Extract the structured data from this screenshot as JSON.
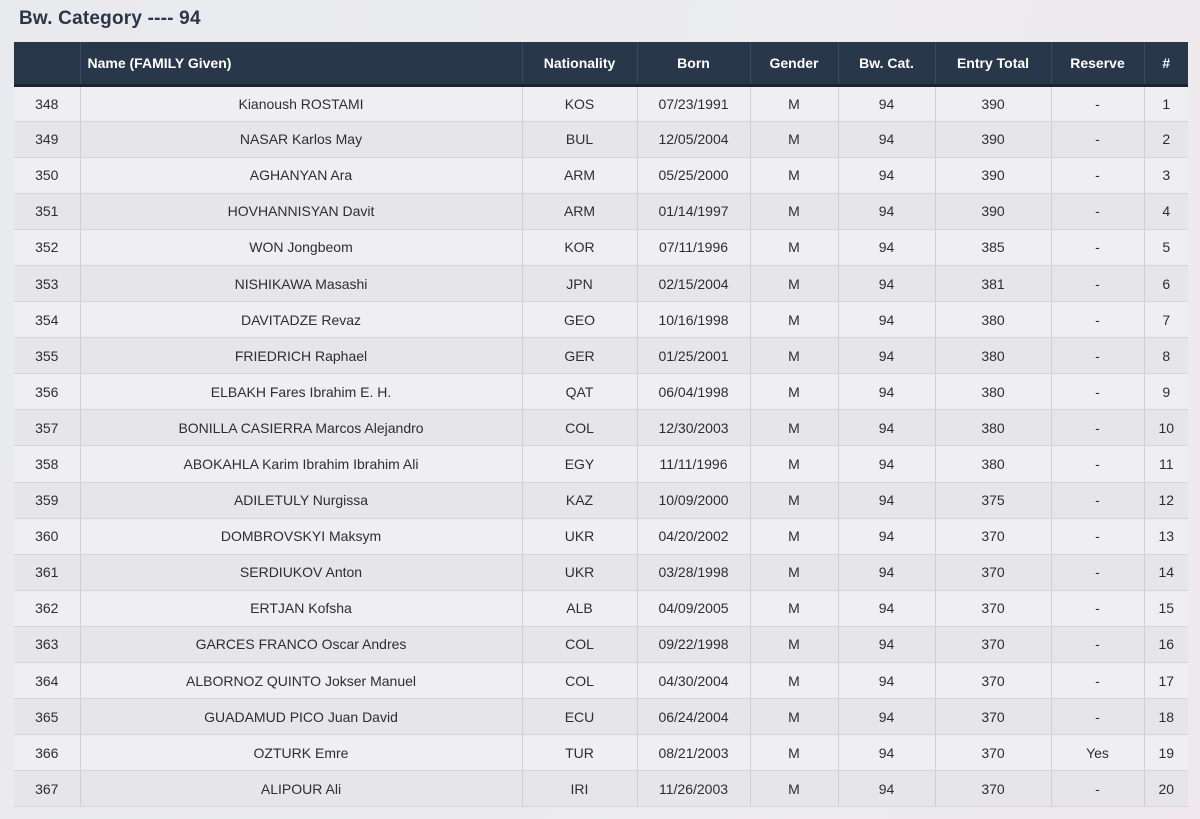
{
  "title": "Bw. Category ---- 94",
  "columns": {
    "id": "",
    "name": "Name (FAMILY Given)",
    "nationality": "Nationality",
    "born": "Born",
    "gender": "Gender",
    "bw_cat": "Bw. Cat.",
    "entry_total": "Entry Total",
    "reserve": "Reserve",
    "rank": "#"
  },
  "rows": [
    {
      "id": "348",
      "name": "Kianoush ROSTAMI",
      "nationality": "KOS",
      "born": "07/23/1991",
      "gender": "M",
      "bw_cat": "94",
      "entry_total": "390",
      "reserve": "-",
      "rank": "1"
    },
    {
      "id": "349",
      "name": "NASAR Karlos May",
      "nationality": "BUL",
      "born": "12/05/2004",
      "gender": "M",
      "bw_cat": "94",
      "entry_total": "390",
      "reserve": "-",
      "rank": "2"
    },
    {
      "id": "350",
      "name": "AGHANYAN Ara",
      "nationality": "ARM",
      "born": "05/25/2000",
      "gender": "M",
      "bw_cat": "94",
      "entry_total": "390",
      "reserve": "-",
      "rank": "3"
    },
    {
      "id": "351",
      "name": "HOVHANNISYAN Davit",
      "nationality": "ARM",
      "born": "01/14/1997",
      "gender": "M",
      "bw_cat": "94",
      "entry_total": "390",
      "reserve": "-",
      "rank": "4"
    },
    {
      "id": "352",
      "name": "WON Jongbeom",
      "nationality": "KOR",
      "born": "07/11/1996",
      "gender": "M",
      "bw_cat": "94",
      "entry_total": "385",
      "reserve": "-",
      "rank": "5"
    },
    {
      "id": "353",
      "name": "NISHIKAWA Masashi",
      "nationality": "JPN",
      "born": "02/15/2004",
      "gender": "M",
      "bw_cat": "94",
      "entry_total": "381",
      "reserve": "-",
      "rank": "6"
    },
    {
      "id": "354",
      "name": "DAVITADZE Revaz",
      "nationality": "GEO",
      "born": "10/16/1998",
      "gender": "M",
      "bw_cat": "94",
      "entry_total": "380",
      "reserve": "-",
      "rank": "7"
    },
    {
      "id": "355",
      "name": "FRIEDRICH Raphael",
      "nationality": "GER",
      "born": "01/25/2001",
      "gender": "M",
      "bw_cat": "94",
      "entry_total": "380",
      "reserve": "-",
      "rank": "8"
    },
    {
      "id": "356",
      "name": "ELBAKH Fares Ibrahim E. H.",
      "nationality": "QAT",
      "born": "06/04/1998",
      "gender": "M",
      "bw_cat": "94",
      "entry_total": "380",
      "reserve": "-",
      "rank": "9"
    },
    {
      "id": "357",
      "name": "BONILLA CASIERRA Marcos Alejandro",
      "nationality": "COL",
      "born": "12/30/2003",
      "gender": "M",
      "bw_cat": "94",
      "entry_total": "380",
      "reserve": "-",
      "rank": "10"
    },
    {
      "id": "358",
      "name": "ABOKAHLA Karim Ibrahim Ibrahim Ali",
      "nationality": "EGY",
      "born": "11/11/1996",
      "gender": "M",
      "bw_cat": "94",
      "entry_total": "380",
      "reserve": "-",
      "rank": "11"
    },
    {
      "id": "359",
      "name": "ADILETULY Nurgissa",
      "nationality": "KAZ",
      "born": "10/09/2000",
      "gender": "M",
      "bw_cat": "94",
      "entry_total": "375",
      "reserve": "-",
      "rank": "12"
    },
    {
      "id": "360",
      "name": "DOMBROVSKYI Maksym",
      "nationality": "UKR",
      "born": "04/20/2002",
      "gender": "M",
      "bw_cat": "94",
      "entry_total": "370",
      "reserve": "-",
      "rank": "13"
    },
    {
      "id": "361",
      "name": "SERDIUKOV Anton",
      "nationality": "UKR",
      "born": "03/28/1998",
      "gender": "M",
      "bw_cat": "94",
      "entry_total": "370",
      "reserve": "-",
      "rank": "14"
    },
    {
      "id": "362",
      "name": "ERTJAN Kofsha",
      "nationality": "ALB",
      "born": "04/09/2005",
      "gender": "M",
      "bw_cat": "94",
      "entry_total": "370",
      "reserve": "-",
      "rank": "15"
    },
    {
      "id": "363",
      "name": "GARCES FRANCO Oscar Andres",
      "nationality": "COL",
      "born": "09/22/1998",
      "gender": "M",
      "bw_cat": "94",
      "entry_total": "370",
      "reserve": "-",
      "rank": "16"
    },
    {
      "id": "364",
      "name": "ALBORNOZ QUINTO Jokser Manuel",
      "nationality": "COL",
      "born": "04/30/2004",
      "gender": "M",
      "bw_cat": "94",
      "entry_total": "370",
      "reserve": "-",
      "rank": "17"
    },
    {
      "id": "365",
      "name": "GUADAMUD PICO Juan David",
      "nationality": "ECU",
      "born": "06/24/2004",
      "gender": "M",
      "bw_cat": "94",
      "entry_total": "370",
      "reserve": "-",
      "rank": "18"
    },
    {
      "id": "366",
      "name": "OZTURK Emre",
      "nationality": "TUR",
      "born": "08/21/2003",
      "gender": "M",
      "bw_cat": "94",
      "entry_total": "370",
      "reserve": "Yes",
      "rank": "19"
    },
    {
      "id": "367",
      "name": "ALIPOUR Ali",
      "nationality": "IRI",
      "born": "11/26/2003",
      "gender": "M",
      "bw_cat": "94",
      "entry_total": "370",
      "reserve": "-",
      "rank": "20"
    }
  ]
}
